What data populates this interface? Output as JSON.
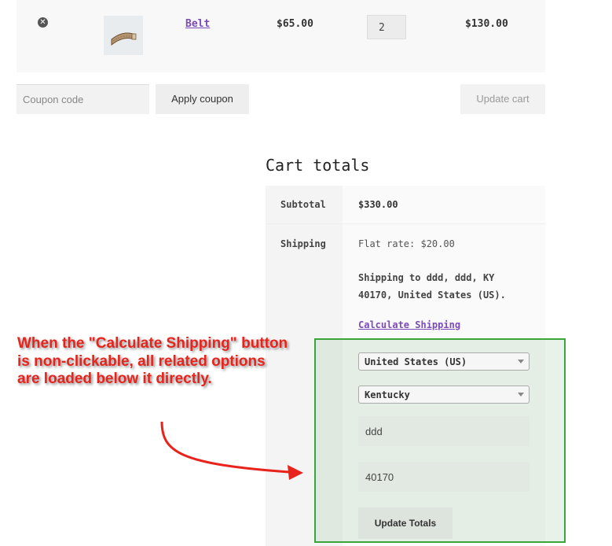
{
  "cart": {
    "item": {
      "remove_icon": "close-circle-icon",
      "product_name": "Belt",
      "price": "$65.00",
      "quantity": "2",
      "subtotal": "$130.00"
    },
    "coupon": {
      "placeholder": "Coupon code"
    },
    "apply_coupon_label": "Apply coupon",
    "update_cart_label": "Update cart"
  },
  "totals": {
    "title": "Cart totals",
    "subtotal_label": "Subtotal",
    "subtotal_value": "$330.00",
    "shipping_label": "Shipping",
    "shipping_rate": "Flat rate: $20.00",
    "shipping_to": "Shipping to ddd, ddd, KY 40170, United States (US).",
    "calculate_link": "Calculate Shipping",
    "country": "United States (US)",
    "state": "Kentucky",
    "city": "ddd",
    "postcode": "40170",
    "update_totals_label": "Update Totals"
  },
  "annotation": {
    "text": "When the \"Calculate Shipping\" button is non-clickable, all related options are loaded below it directly.",
    "color": "#e8231c",
    "highlight_color": "#3aa63a"
  }
}
